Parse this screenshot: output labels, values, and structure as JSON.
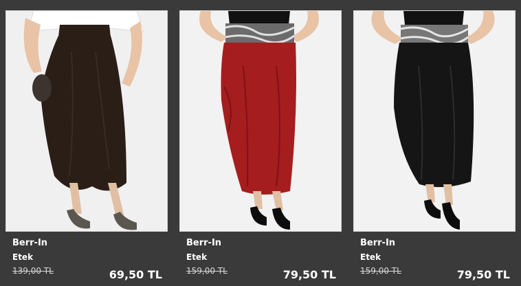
{
  "products": [
    {
      "brand": "Berr-In",
      "type": "Etek",
      "old_price": "139,00 TL",
      "new_price": "69,50 TL",
      "image": "brown-draped-skirt-photo",
      "skirt_color": "#2a1e17"
    },
    {
      "brand": "Berr-In",
      "type": "Etek",
      "old_price": "159,00 TL",
      "new_price": "79,50 TL",
      "image": "red-draped-skirt-photo",
      "skirt_color": "#a51d1e"
    },
    {
      "brand": "Berr-In",
      "type": "Etek",
      "old_price": "159,00 TL",
      "new_price": "79,50 TL",
      "image": "black-draped-skirt-photo",
      "skirt_color": "#151515"
    }
  ]
}
